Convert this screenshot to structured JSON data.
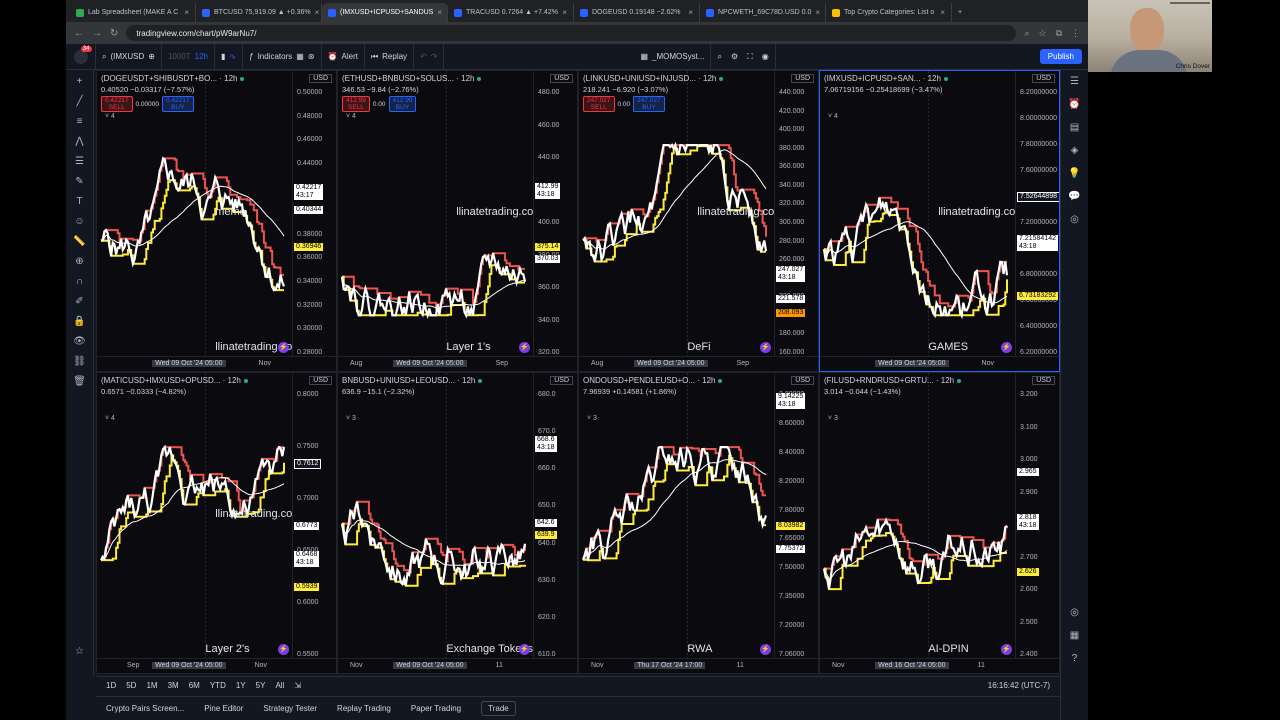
{
  "browser": {
    "tabs": [
      {
        "label": "Lab Spreadsheet (MAKE A C",
        "active": false
      },
      {
        "label": "BTCUSD 75,919.09 ▲ +0.36%",
        "active": false
      },
      {
        "label": "(IMXUSD+ICPUSD+SANDUS",
        "active": true
      },
      {
        "label": "TRACUSD 0.7264 ▲ +7.42%",
        "active": false
      },
      {
        "label": "DOGEUSD 0.19148 −2.62%",
        "active": false
      },
      {
        "label": "NPCWETH_69C78D.USD 0.0",
        "active": false
      },
      {
        "label": "Top Crypto Categories: List o",
        "active": false
      }
    ],
    "url": "tradingview.com/chart/pW9arNu7/",
    "profile_badge": "34"
  },
  "toolbar": {
    "symbol": "(IMXUSD",
    "interval_muted": "1000T",
    "interval": "12h",
    "indicators": "Indicators",
    "alert": "Alert",
    "replay": "Replay",
    "layout_name": "_MOMOSyst...",
    "publish": "Publish"
  },
  "charts": [
    {
      "title": "(DOGEUSDT+SHIBUSDT+BO... · 12h",
      "ohlc": "0.40520  −0.03317 (−7.57%)",
      "sell_price": "0.42217",
      "mid_price": "0.00000",
      "buy_price": "0.42217",
      "ind_count": "4",
      "axis_ticks": [
        "0.50000",
        "0.48000",
        "0.46000",
        "0.44000",
        "0.42000",
        "0.40000",
        "0.38000",
        "0.36000",
        "0.34000",
        "0.32000",
        "0.30000",
        "0.28000"
      ],
      "badges": [
        {
          "text": "0.42217",
          "sub": "43:17",
          "kind": "white",
          "pos": 0.395
        },
        {
          "text": "0.40344",
          "kind": "white",
          "pos": 0.47
        },
        {
          "text": "0.36946",
          "kind": "yellow",
          "pos": 0.6
        }
      ],
      "x_labels": [
        "Nov"
      ],
      "crosshair_date": "Wed 09 Oct '24  05:00",
      "watermark": "meme",
      "footer_watermark": "llinatetrading.co",
      "category": ""
    },
    {
      "title": "(ETHUSD+BNBUSD+SOLUS... · 12h",
      "ohlc": "346.53  −9.84 (−2.76%)",
      "sell_price": "412.99",
      "mid_price": "0.00",
      "buy_price": "412.99",
      "ind_count": "4",
      "axis_ticks": [
        "480.00",
        "460.00",
        "440.00",
        "420.00",
        "400.00",
        "380.00",
        "360.00",
        "340.00",
        "320.00"
      ],
      "badges": [
        {
          "text": "412.99",
          "sub": "43:18",
          "kind": "white",
          "pos": 0.39
        },
        {
          "text": "375.14",
          "kind": "yellow",
          "pos": 0.6
        },
        {
          "text": "370.03",
          "kind": "white",
          "pos": 0.64
        }
      ],
      "x_labels": [
        "Aug",
        "Sep"
      ],
      "crosshair_date": "Wed 09 Oct '24  05:00",
      "watermark": "llinatetrading.co",
      "footer_watermark": "",
      "category": "Layer 1's"
    },
    {
      "title": "(LINKUSD+UNIUSD+INJUSD... · 12h",
      "ohlc": "218.241  −6.920 (−3.07%)",
      "sell_price": "247.027",
      "mid_price": "0.00",
      "buy_price": "247.027",
      "ind_count": "",
      "axis_ticks": [
        "440.000",
        "420.000",
        "400.000",
        "380.000",
        "360.000",
        "340.000",
        "320.000",
        "300.000",
        "280.000",
        "260.000",
        "240.000",
        "220.000",
        "200.000",
        "180.000",
        "160.000"
      ],
      "badges": [
        {
          "text": "247.027",
          "sub": "43:18",
          "kind": "white",
          "pos": 0.68
        },
        {
          "text": "221.578",
          "kind": "white",
          "pos": 0.78
        },
        {
          "text": "208.093",
          "kind": "orange",
          "pos": 0.83
        }
      ],
      "x_labels": [
        "Aug",
        "Sep"
      ],
      "crosshair_date": "Wed 09 Oct '24  05:00",
      "watermark": "llinatetrading.co",
      "footer_watermark": "",
      "category": "DeFi"
    },
    {
      "title": "(IMXUSD+ICPUSD+SAN... · 12h",
      "ohlc": "7.06719156  −0.25418699 (−3.47%)",
      "sell_price": "",
      "mid_price": "",
      "buy_price": "",
      "ind_count": "4",
      "axis_ticks": [
        "8.20000000",
        "8.00000000",
        "7.80000000",
        "7.60000000",
        "7.40000000",
        "7.20000000",
        "7.00000000",
        "6.80000000",
        "6.60000000",
        "6.40000000",
        "6.20000000"
      ],
      "badges": [
        {
          "text": "7.52644898",
          "kind": "dark",
          "pos": 0.42
        },
        {
          "text": "7.21584142",
          "sub": "43:18",
          "kind": "white",
          "pos": 0.57
        },
        {
          "text": "6.73183292",
          "kind": "yellow",
          "pos": 0.77
        }
      ],
      "x_labels": [
        "Nov"
      ],
      "crosshair_date": "Wed 09 Oct '24  05:00",
      "watermark": "llinatetrading.co",
      "footer_watermark": "",
      "category": "GAMES"
    },
    {
      "title": "(MATICUSD+IMXUSD+OPUSD... · 12h",
      "ohlc": "0.6571  −0.0333 (−4.82%)",
      "sell_price": "",
      "mid_price": "",
      "buy_price": "",
      "ind_count": "4",
      "axis_ticks": [
        "0.8000",
        "0.7500",
        "0.7000",
        "0.6500",
        "0.6000",
        "0.5500"
      ],
      "badges": [
        {
          "text": "0.7612",
          "kind": "dark",
          "pos": 0.3
        },
        {
          "text": "0.6773",
          "kind": "white",
          "pos": 0.52
        },
        {
          "text": "0.6468",
          "sub": "43:18",
          "kind": "white",
          "pos": 0.62
        },
        {
          "text": "0.5939",
          "kind": "yellow",
          "pos": 0.73
        }
      ],
      "x_labels": [
        "Sep",
        "Nov"
      ],
      "crosshair_date": "Wed 09 Oct '24  05:00",
      "watermark": "llinatetrading.co",
      "footer_watermark": "",
      "category": "Layer 2's"
    },
    {
      "title": "BNBUSD+UNIUSD+LEOUSD... · 12h",
      "ohlc": "636.9  −15.1 (−2.32%)",
      "sell_price": "",
      "mid_price": "",
      "buy_price": "",
      "ind_count": "3",
      "axis_ticks": [
        "680.0",
        "670.0",
        "660.0",
        "650.0",
        "640.0",
        "630.0",
        "620.0",
        "610.0"
      ],
      "badges": [
        {
          "text": "668.6",
          "sub": "43:18",
          "kind": "white",
          "pos": 0.22
        },
        {
          "text": "642.6",
          "kind": "white",
          "pos": 0.51
        },
        {
          "text": "639.9",
          "kind": "yellow",
          "pos": 0.55
        }
      ],
      "x_labels": [
        "Nov",
        "11"
      ],
      "crosshair_date": "Wed 09 Oct '24  05:00",
      "watermark": "",
      "footer_watermark": "",
      "category": "Exchange Tokens"
    },
    {
      "title": "ONDOUSD+PENDLEUSD+O... · 12h",
      "ohlc": "7.96939  +0.14581 (+1.86%)",
      "sell_price": "",
      "mid_price": "",
      "buy_price": "",
      "ind_count": "3",
      "axis_ticks": [
        "8.80000",
        "8.60000",
        "8.40000",
        "8.20000",
        "7.80000",
        "7.65000",
        "7.50000",
        "7.35000",
        "7.20000",
        "7.06000"
      ],
      "badges": [
        {
          "text": "9.14225",
          "sub": "43:18",
          "kind": "white",
          "pos": 0.07
        },
        {
          "text": "8.03982",
          "kind": "yellow",
          "pos": 0.52
        },
        {
          "text": "7.75372",
          "kind": "white",
          "pos": 0.6
        }
      ],
      "x_labels": [
        "Nov",
        "11"
      ],
      "crosshair_date": "Thu 17 Oct '24  17:00",
      "watermark": "",
      "footer_watermark": "",
      "category": "RWA"
    },
    {
      "title": "(FILUSD+RNDRUSD+GRTU... · 12h",
      "ohlc": "3.014  −0.044 (−1.43%)",
      "sell_price": "",
      "mid_price": "",
      "buy_price": "",
      "ind_count": "3",
      "axis_ticks": [
        "3.200",
        "3.100",
        "3.000",
        "2.900",
        "2.800",
        "2.700",
        "2.600",
        "2.500",
        "2.400"
      ],
      "badges": [
        {
          "text": "2.965",
          "kind": "white",
          "pos": 0.33
        },
        {
          "text": "2.818",
          "sub": "43:18",
          "kind": "white",
          "pos": 0.49
        },
        {
          "text": "2.626",
          "kind": "yellow",
          "pos": 0.68
        }
      ],
      "x_labels": [
        "Nov",
        "11"
      ],
      "crosshair_date": "Wed 16 Oct '24  05:00",
      "watermark": "",
      "footer_watermark": "",
      "category": "AI-DPIN"
    }
  ],
  "timeframes": [
    "1D",
    "5D",
    "1M",
    "3M",
    "6M",
    "YTD",
    "1Y",
    "5Y",
    "All"
  ],
  "clock": "16:16:42 (UTC-7)",
  "bottom_tabs": [
    "Crypto Pairs Screen...",
    "Pine Editor",
    "Strategy Tester",
    "Replay Trading",
    "Paper Trading",
    "Trade"
  ],
  "webcam": {
    "name": "Chris Dover"
  },
  "colors": {
    "accent": "#2962ff",
    "price": "#ffffff",
    "red_line": "#ef5350",
    "yellow_line": "#ffeb3b"
  }
}
